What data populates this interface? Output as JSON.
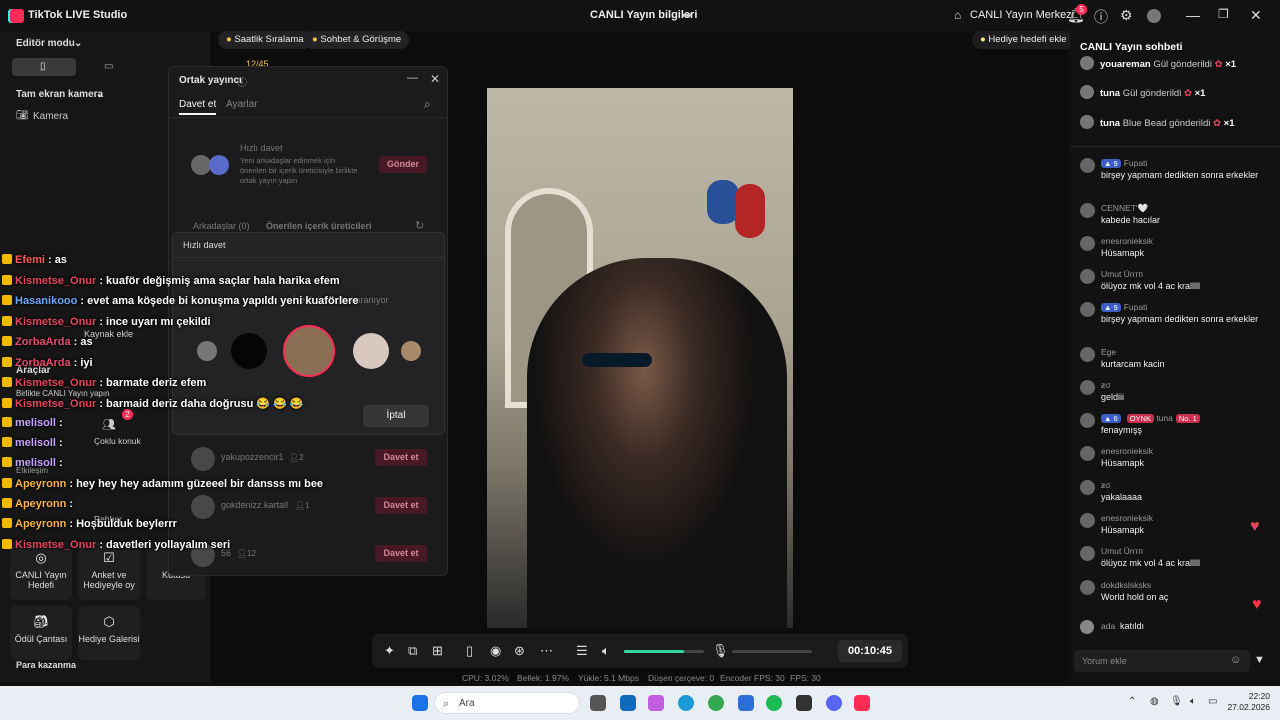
{
  "titlebar": {
    "app_title": "TikTok LIVE Studio",
    "center_title": "CANLI Yayın bilgileri",
    "home_label": "CANLI Yayın Merkezi",
    "notification_count": "5"
  },
  "left_panel": {
    "editor_mode": "Editör modu",
    "camera_source": "Tam ekran kamera",
    "camera_item": "Kamera",
    "add_source": "Kaynak ekle",
    "tools_heading": "Araçlar",
    "tools_sub": "Birlikte CANLI Yayın yapın",
    "multi_guest": "Çoklu konuk",
    "multi_guest_badge": "2",
    "interaction": "Etkileşim",
    "guide": "Rehber",
    "tiles": [
      {
        "label": "CANLI Yayın Hedefi"
      },
      {
        "label": "Anket ve Hediyeyle oy"
      },
      {
        "label": "Kutusu"
      },
      {
        "label": "Ödül Çantası"
      },
      {
        "label": "Hediye Galerisi"
      }
    ],
    "earn_heading": "Para kazanma"
  },
  "top_pills": {
    "hourly_ranking": "Saatlik Sıralama",
    "chat_meet": "Sohbet & Görüşme",
    "counter": "12/45",
    "gift_goal": "Hediye hedefi ekle"
  },
  "cohost_modal": {
    "title": "Ortak yayıncı",
    "tab_invite": "Davet et",
    "tab_settings": "Ayarlar",
    "quick_invite_title": "Hızlı davet",
    "quick_invite_desc": "Yeni arkadaşlar edinmek için önerilen bir içerik üreticisiyle birlikte ortak yayın yapın",
    "send_button": "Gönder",
    "friends_tab": "Arkadaşlar (0)",
    "suggested_tab": "Önerilen içerik üreticileri",
    "suggestions": [
      {
        "name": "yakupozzencir1",
        "count": "2",
        "button": "Davet et"
      },
      {
        "name": "gokdenizz.kartall",
        "count": "1",
        "button": "Davet et"
      },
      {
        "name": "56",
        "count": "12",
        "button": "Davet et"
      }
    ]
  },
  "quick_popup": {
    "title": "Hızlı davet",
    "searching": "İçerik üreticileri aranıyor",
    "cancel": "İptal"
  },
  "overlay_chat": [
    {
      "name": "Efemi",
      "text": ": as",
      "color": "#ff5a5a"
    },
    {
      "name": "Kismetse_Onur",
      "text": ": kuaför değişmiş ama saçlar hala harika efem",
      "color": "#e8455a"
    },
    {
      "name": "Hasanikooo",
      "text": ": evet ama köşede bi konuşma yapıldı yeni kuaförlere",
      "color": "#6fa8ff"
    },
    {
      "name": "Kismetse_Onur",
      "text": ": ince uyarı mı çekildi",
      "color": "#e8455a"
    },
    {
      "name": "ZorbaArda",
      "text": ": as",
      "color": "#e84b6a"
    },
    {
      "name": "ZorbaArda",
      "text": ": iyi",
      "color": "#e84b6a"
    },
    {
      "name": "Kismetse_Onur",
      "text": ": barmate deriz efem",
      "color": "#e8455a"
    },
    {
      "name": "Kismetse_Onur",
      "text": ": barmaid deriz daha doğrusu 😂 😂 😂",
      "color": "#e8455a"
    },
    {
      "name": "melisoll",
      "text": ":",
      "color": "#c7a6ff"
    },
    {
      "name": "melisoll",
      "text": ":",
      "color": "#c7a6ff"
    },
    {
      "name": "melisoll",
      "text": ":",
      "color": "#c7a6ff"
    },
    {
      "name": "Apeyronn",
      "text": ": hey hey hey adamım güzeeel bir dansss mı bee",
      "color": "#ffb347"
    },
    {
      "name": "Apeyronn",
      "text": ":",
      "color": "#ffb347"
    },
    {
      "name": "Apeyronn",
      "text": ": Hoşbulduk beylerrr",
      "color": "#ffb347"
    },
    {
      "name": "Kismetse_Onur",
      "text": ": davetleri yollayalım seri",
      "color": "#e8455a"
    }
  ],
  "right_panel": {
    "title": "CANLI Yayın sohbeti",
    "gifts": [
      {
        "name": "youareman",
        "action": "Gül gönderildi",
        "qty": "×1"
      },
      {
        "name": "tuna",
        "action": "Gül gönderildi",
        "qty": "×1"
      },
      {
        "name": "tuna",
        "action": "Blue Bead gönderildi",
        "qty": "×1"
      }
    ],
    "messages": [
      {
        "name": "Fupati",
        "level": "9",
        "text": "birşey yapmam dedikten sonra erkekler"
      },
      {
        "name": "CENNET'🤍",
        "level": "",
        "text": "kabede hacılar"
      },
      {
        "name": "enesronieksik",
        "level": "",
        "text": "Hüsamapk"
      },
      {
        "name": "Umut Ünтп",
        "level": "",
        "text": "ölüyoz mk vol 4 ac kralllll"
      },
      {
        "name": "Fupati",
        "level": "9",
        "text": "birşey yapmam dedikten sonra erkekler"
      },
      {
        "name": "Ege",
        "level": "",
        "text": "kurtarcam kacin"
      },
      {
        "name": "ƶσ",
        "level": "",
        "text": "geldiii"
      },
      {
        "name": "tuna",
        "level": "6",
        "text": "fenaymışş",
        "tag": "OYNK",
        "rank": "No. 1"
      },
      {
        "name": "enesronieksik",
        "level": "",
        "text": "Hüsamapk"
      },
      {
        "name": "ƶσ",
        "level": "",
        "text": "yakalaaaa"
      },
      {
        "name": "enesronieksik",
        "level": "",
        "text": "Hüsamapk"
      },
      {
        "name": "Umut Ünтп",
        "level": "",
        "text": "ölüyoz mk vol 4 ac kralllll"
      },
      {
        "name": "dokdkslsksks",
        "level": "",
        "text": "World hold on aç"
      }
    ],
    "join_name": "ada",
    "join_text": "katıldı",
    "comment_placeholder": "Yorum ekle"
  },
  "controls": {
    "timer": "00:10:45",
    "volume": 0.75
  },
  "statusbar": {
    "cpu": "CPU: 3.02%",
    "memory": "Bellek: 1.97%",
    "upload": "Yükle: 5.1 Mbps",
    "dropped": "Düşen çerçeve: 0",
    "encoder_fps": "Encoder FPS: 30",
    "fps": "FPS: 30"
  },
  "taskbar": {
    "search_placeholder": "Ara",
    "time": "22:20",
    "date": "27.02.2026"
  }
}
